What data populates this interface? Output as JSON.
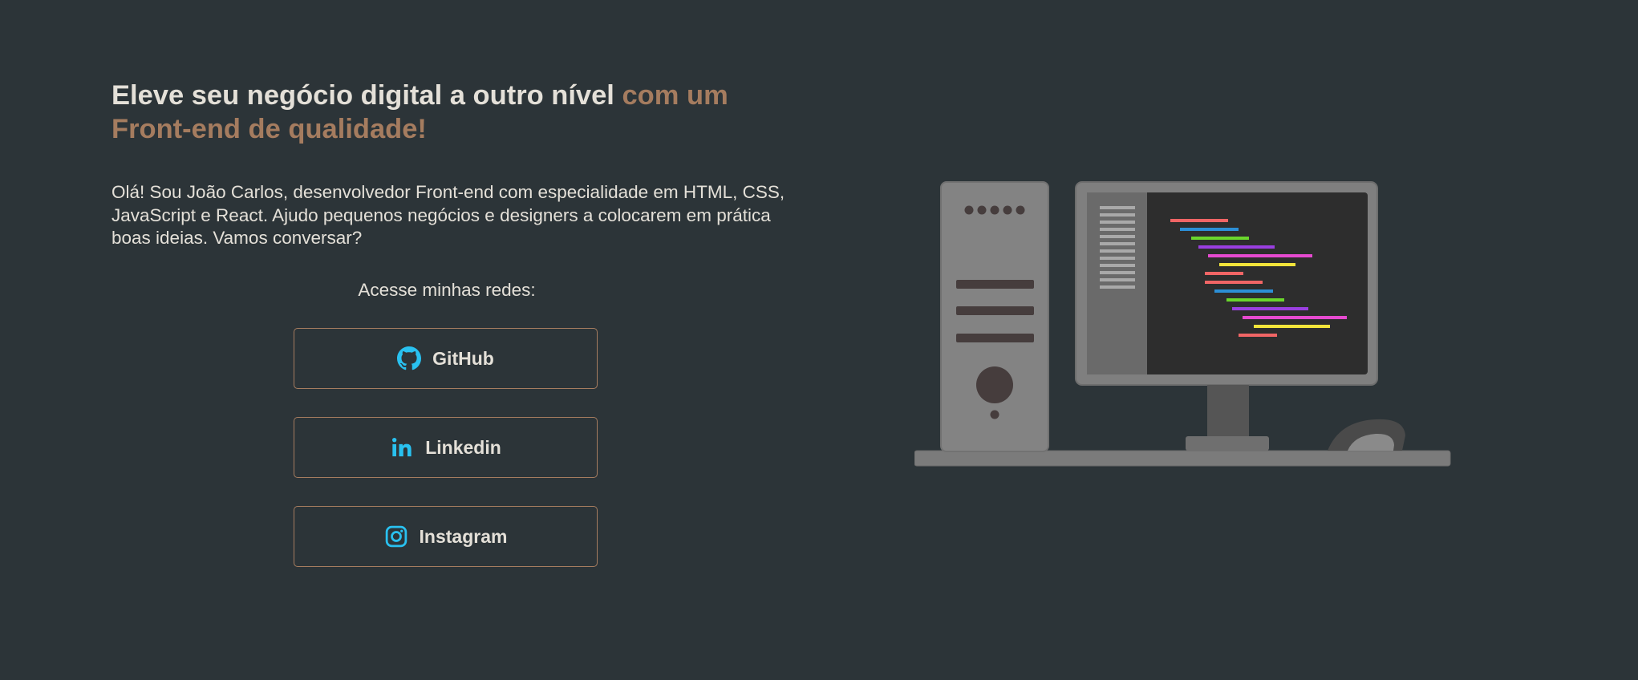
{
  "hero": {
    "headline_main": "Eleve seu negócio digital a outro nível ",
    "headline_accent": "com um Front-end de qualidade!",
    "intro": "Olá! Sou João Carlos, desenvolvedor Front-end com especialidade em HTML, CSS, JavaScript e React. Ajudo pequenos negócios e designers a colocarem em prática boas ideias. Vamos conversar?"
  },
  "social": {
    "title": "Acesse minhas redes:",
    "links": [
      {
        "label": "GitHub",
        "icon": "github-icon"
      },
      {
        "label": "Linkedin",
        "icon": "linkedin-icon"
      },
      {
        "label": "Instagram",
        "icon": "instagram-icon"
      }
    ]
  },
  "illustration": {
    "icon": "desktop-computer-illustration"
  },
  "colors": {
    "background": "#2c3438",
    "text": "#e4e0d8",
    "accent": "#a57c5f",
    "icon": "#29c1f0"
  }
}
